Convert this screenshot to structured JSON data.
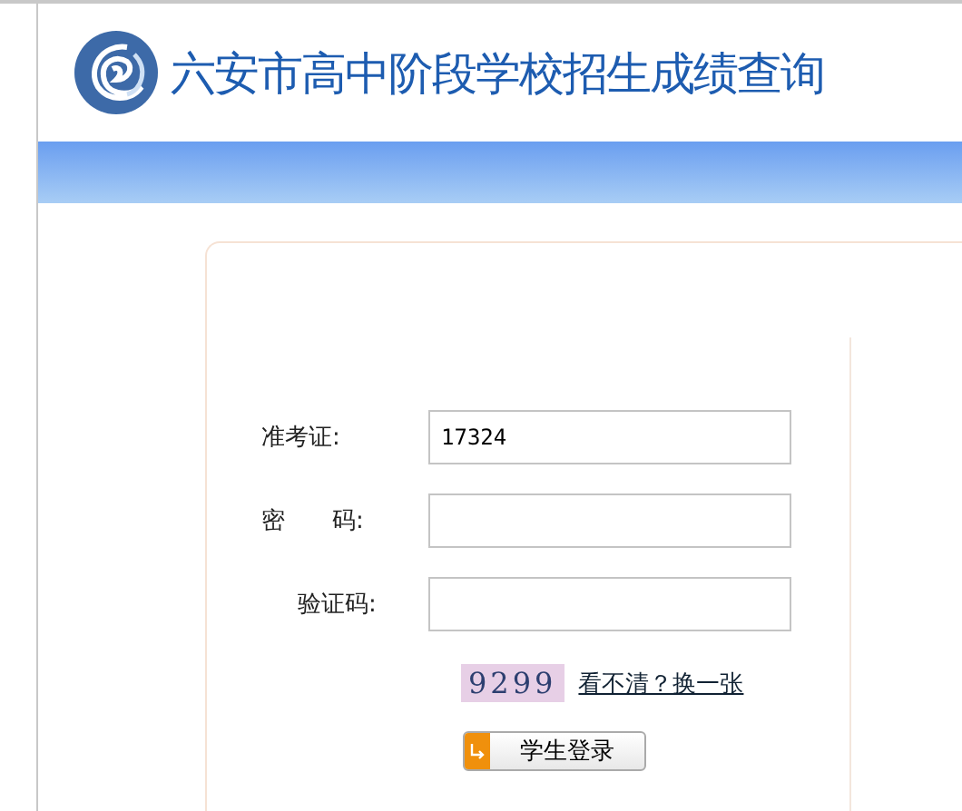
{
  "header": {
    "title": "六安市高中阶段学校招生成绩查询"
  },
  "form": {
    "fields": [
      {
        "label": "准考证:",
        "value": "17324"
      },
      {
        "label": "密　　码:"
      },
      {
        "label": "验证码:"
      }
    ],
    "captcha": "9299",
    "refresh_link": "看不清？换一张",
    "submit_button": "学生登录"
  }
}
